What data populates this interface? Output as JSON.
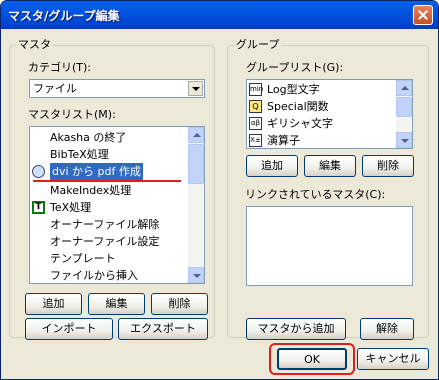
{
  "window": {
    "title": "マスタ/グループ編集"
  },
  "master": {
    "group_label": "マスタ",
    "category_label": "カテゴリ(T):",
    "category_value": "ファイル",
    "list_label": "マスタリスト(M):",
    "items": [
      {
        "label": "Akasha の終了"
      },
      {
        "label": "BibTeX処理"
      },
      {
        "label": "dvi から pdf 作成",
        "selected": true
      },
      {
        "label": "MakeIndex処理"
      },
      {
        "label": "TeX処理"
      },
      {
        "label": "オーナーファイル解除"
      },
      {
        "label": "オーナーファイル設定"
      },
      {
        "label": "テンプレート"
      },
      {
        "label": "ファイルから挿入"
      }
    ],
    "add_label": "追加",
    "edit_label": "編集",
    "delete_label": "削除",
    "import_label": "インポート",
    "export_label": "エクスポート"
  },
  "group": {
    "group_label": "グループ",
    "list_label": "グループリスト(G):",
    "items": [
      {
        "label": "Log型文字",
        "icon_text": "min"
      },
      {
        "label": "Special関数",
        "icon_text": "Q"
      },
      {
        "label": "ギリシャ文字",
        "icon_text": "αβ"
      },
      {
        "label": "演算子",
        "icon_text": "X±"
      }
    ],
    "add_label": "追加",
    "edit_label": "編集",
    "delete_label": "削除",
    "linked_label": "リンクされているマスタ(C):",
    "add_from_master_label": "マスタから追加",
    "unlink_label": "解除"
  },
  "footer": {
    "ok_label": "OK",
    "cancel_label": "キャンセル"
  },
  "colors": {
    "titlebar": "#0054e3",
    "selection": "#316ac5",
    "annotation": "#e02020"
  }
}
